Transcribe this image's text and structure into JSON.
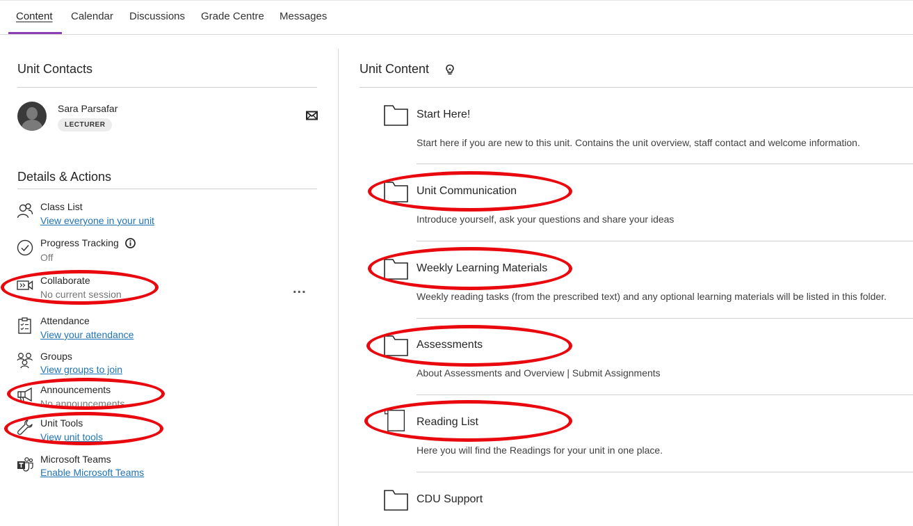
{
  "tabs": [
    {
      "label": "Content",
      "active": true
    },
    {
      "label": "Calendar",
      "active": false
    },
    {
      "label": "Discussions",
      "active": false
    },
    {
      "label": "Grade Centre",
      "active": false
    },
    {
      "label": "Messages",
      "active": false
    }
  ],
  "accent_color": "#8b3fb5",
  "link_color": "#1f73b7",
  "annotation_color": "#e8080d",
  "unit_contacts": {
    "title": "Unit Contacts",
    "contact": {
      "name": "Sara Parsafar",
      "role": "LECTURER",
      "avatar_icon": "person-silhouette",
      "action_icon": "envelope-icon"
    }
  },
  "details_actions": {
    "title": "Details & Actions",
    "items": [
      {
        "title": "Class List",
        "link": "View everyone in your unit",
        "icon": "people-icon"
      },
      {
        "title": "Progress Tracking",
        "sub": "Off",
        "icon": "check-circle-icon"
      },
      {
        "title": "Collaborate",
        "sub": "No current session",
        "icon": "video-icon",
        "more": "..."
      },
      {
        "title": "Attendance",
        "link": "View your attendance",
        "icon": "checklist-icon"
      },
      {
        "title": "Groups",
        "link": "View groups to join",
        "icon": "groups-icon"
      },
      {
        "title": "Announcements",
        "sub": "No announcements",
        "icon": "megaphone-icon"
      },
      {
        "title": "Unit Tools",
        "link": "View unit tools",
        "icon": "wrench-icon"
      },
      {
        "title": "Microsoft Teams",
        "link": "Enable Microsoft Teams",
        "icon": "teams-icon"
      }
    ]
  },
  "unit_content": {
    "title": "Unit Content",
    "items": [
      {
        "title": "Start Here!",
        "desc": "Start here if you are new to this unit. Contains the unit overview, staff contact and welcome information.",
        "icon": "folder-icon"
      },
      {
        "title": "Unit Communication",
        "desc": "Introduce yourself, ask your questions and share your ideas",
        "icon": "folder-icon"
      },
      {
        "title": "Weekly Learning Materials",
        "desc": "Weekly reading tasks (from the prescribed text) and any optional learning materials will be listed in this folder.",
        "icon": "folder-icon"
      },
      {
        "title": "Assessments",
        "desc": "About Assessments and Overview | Submit Assignments",
        "icon": "folder-icon"
      },
      {
        "title": "Reading List",
        "desc": "Here you will find the Readings for your unit in one place.",
        "icon": "document-icon"
      },
      {
        "title": "CDU Support",
        "icon": "folder-icon"
      }
    ]
  }
}
